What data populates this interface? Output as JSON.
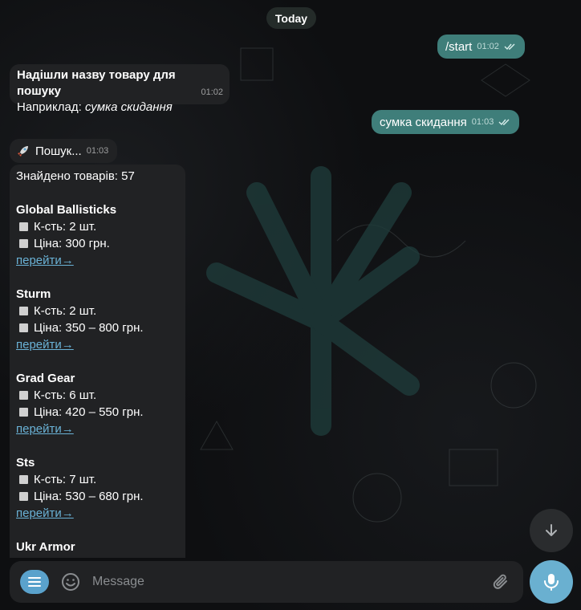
{
  "date_label": "Today",
  "messages": {
    "start": {
      "text": "/start",
      "time": "01:02"
    },
    "prompt": {
      "line1": "Надішли назву товару для пошуку",
      "line2_prefix": "Наприклад: ",
      "line2_example": "сумка скидання",
      "time": "01:02"
    },
    "query": {
      "text": "сумка скидання",
      "time": "01:03"
    },
    "searching": {
      "icon": "rocket",
      "text": "Пошук...",
      "time": "01:03"
    },
    "results": {
      "count_text": "Знайдено товарів: 57",
      "products": [
        {
          "name": "Global Ballisticks",
          "qty": "К-сть: 2 шт.",
          "price": "Ціна: 300 грн.",
          "link": "перейти→"
        },
        {
          "name": "Sturm",
          "qty": "К-сть: 2 шт.",
          "price": "Ціна: 350 – 800 грн.",
          "link": "перейти→"
        },
        {
          "name": "Grad Gear",
          "qty": "К-сть: 6 шт.",
          "price": "Ціна: 420 – 550 грн.",
          "link": "перейти→"
        },
        {
          "name": "Sts",
          "qty": "К-сть: 7 шт.",
          "price": "Ціна: 530 – 680 грн.",
          "link": "перейти→"
        },
        {
          "name": "Ukr Armor"
        }
      ]
    }
  },
  "composer": {
    "placeholder": "Message"
  },
  "colors": {
    "outgoing_bubble": "#3f7e7a",
    "incoming_bubble": "#212224",
    "accent": "#6ab0d0",
    "link": "#6ab2d6"
  }
}
